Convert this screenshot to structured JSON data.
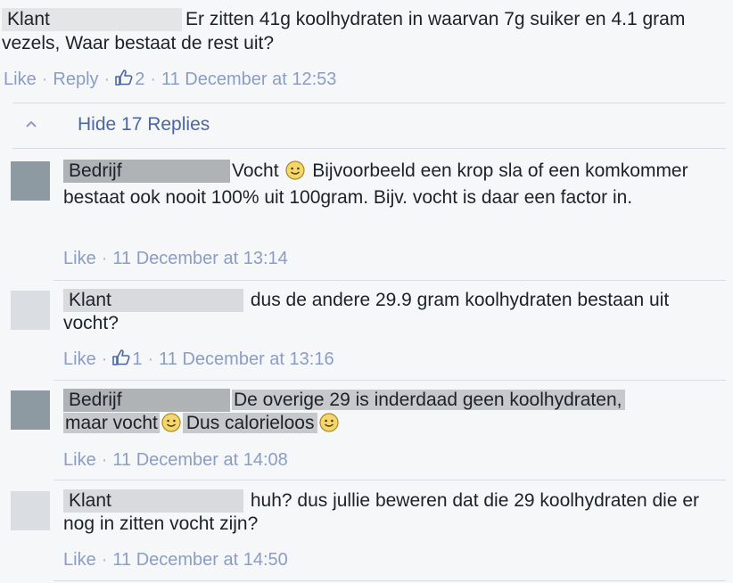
{
  "main_comment": {
    "author": "Klant",
    "text": "Er zitten 41g koolhydraten in waarvan 7g suiker en 4.1 gram vezels, Waar bestaat de rest uit?",
    "like_label": "Like",
    "reply_label": "Reply",
    "like_count": "2",
    "timestamp": "11 December at 12:53"
  },
  "replies_toggle": {
    "label": "Hide 17 Replies"
  },
  "replies": [
    {
      "author": "Bedrijf",
      "text_a": "Vocht",
      "text_b": "Bijvoorbeeld een krop sla of een komkommer bestaat ook nooit 100% uit 100gram. Bijv. vocht is daar een factor in.",
      "like_label": "Like",
      "timestamp": "11 December at 13:14"
    },
    {
      "author": "Klant",
      "text": "dus de andere 29.9 gram koolhydraten bestaan uit vocht?",
      "like_label": "Like",
      "like_count": "1",
      "timestamp": "11 December at 13:16"
    },
    {
      "author": "Bedrijf",
      "text_a": "De overige 29 is inderdaad geen koolhydraten,",
      "text_b": "maar vocht",
      "text_c": "Dus calorieloos",
      "like_label": "Like",
      "timestamp": "11 December at 14:08"
    },
    {
      "author": "Klant",
      "text": "huh? dus jullie beweren dat die 29 koolhydraten die er nog in zitten vocht zijn?",
      "like_label": "Like",
      "timestamp": "11 December at 14:50"
    }
  ],
  "separator": "·",
  "colors": {
    "link": "#4b66a0",
    "meta": "#8b9dc3",
    "background": "#f6f7f9"
  }
}
